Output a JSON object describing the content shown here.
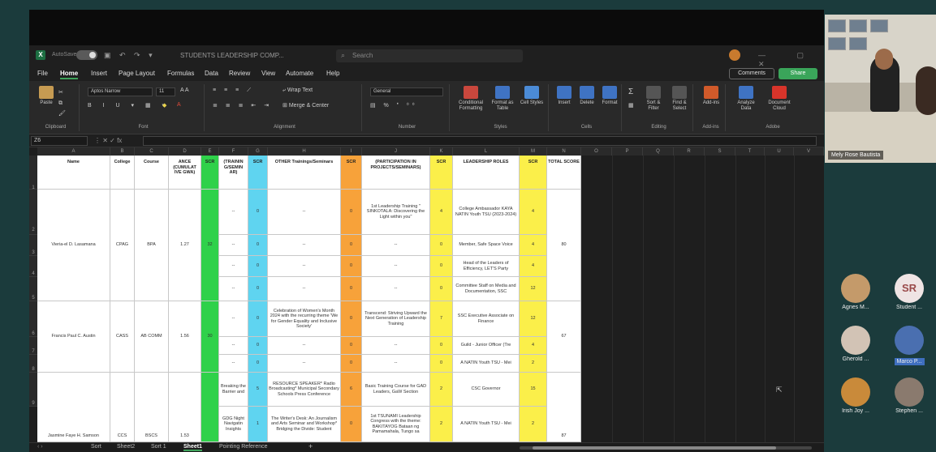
{
  "excel": {
    "title_bar": {
      "autosave": "AutoSave",
      "filename": "STUDENTS LEADERSHIP COMP...",
      "search_placeholder": "Search"
    },
    "menus": [
      "File",
      "Home",
      "Insert",
      "Page Layout",
      "Formulas",
      "Data",
      "Review",
      "View",
      "Automate",
      "Help"
    ],
    "comments_label": "Comments",
    "share_label": "Share",
    "ribbon": {
      "paste": "Paste",
      "clipboard": "Clipboard",
      "font_name": "Aptos Narrow",
      "font_size": "11",
      "font_group": "Font",
      "wrap_text": "Wrap Text",
      "merge_center": "Merge & Center",
      "alignment": "Alignment",
      "number_format": "General",
      "number": "Number",
      "conditional_formatting": "Conditional Formatting",
      "format_as_table": "Format as Table",
      "cell_styles": "Cell Styles",
      "styles": "Styles",
      "insert": "Insert",
      "delete": "Delete",
      "format": "Format",
      "cells": "Cells",
      "sort_filter": "Sort & Filter",
      "find_select": "Find & Select",
      "editing": "Editing",
      "addins": "Add-ins",
      "addins_group": "Add-ins",
      "analyze_data": "Analyze Data",
      "document_cloud": "Document Cloud",
      "adobe": "Adobe"
    },
    "name_box": "Z6",
    "columns": [
      "A",
      "B",
      "C",
      "D",
      "E",
      "F",
      "G",
      "H",
      "I",
      "J",
      "K",
      "L",
      "M",
      "N",
      "O",
      "P",
      "Q",
      "R",
      "S",
      "T",
      "U",
      "V"
    ],
    "rows": [
      "1",
      "2",
      "3",
      "4",
      "5",
      "6",
      "7",
      "8",
      "9"
    ],
    "headers": {
      "name": "Name",
      "college": "College",
      "course": "Course",
      "gwa": "ANCE (CUMULAT IVE GWA)",
      "scr": "SCR",
      "trainings": "(TRAININ G/SEMIN AR)",
      "other": "OTHER Trainings/Seminars",
      "projects": "(PARTICIPATION IN PROJECTS/SEMINARS)",
      "leadership": "LEADERSHIP ROLES",
      "total": "TOTAL SCORE"
    },
    "students": [
      {
        "name": "Vieria-el D. Lasamana",
        "college": "CPAG",
        "course": "BPA",
        "gwa": "1.27",
        "total": "80"
      },
      {
        "name": "Francis Paul C. Austin",
        "college": "CASS",
        "course": "AB COMM",
        "gwa": "1.56",
        "total": "67"
      },
      {
        "name": "Jasmine Faye H. Samson",
        "college": "CCS",
        "course": "BSCS",
        "gwa": "1.53",
        "total": "87"
      }
    ],
    "cells": {
      "dash": "--",
      "proj1": "1st Leadership Training \" SINKOTALA: Discovering the Light within you\"",
      "lead1": "College Ambassador KAYA NATIN Youth TSU (2023-2024)",
      "lead2": "Member, Safe Space Voice",
      "lead3": "Head of the Leaders of Efficiency, LET'S Party",
      "lead4": "Committee Staff on Media and Documentation, SSC",
      "other5": "Celebration of Women's Month 2024 with the recurring theme 'We for Gender Equality and Inclusive Society'",
      "proj5": "Transcend: Striving Upward the Next Generation of Leadership Training",
      "lead5": "SSC Executive Associate on Finance",
      "lead6": "Guild - Junior Officer (Tre",
      "lead7": "A NATIN Youth TSU - Mei",
      "train8": "Breaking the Barrier and",
      "other8": "RESOURCE SPEAKER* Radio Broadcasting* Municipal Secondary Schools Press Conference",
      "proj8": "Basic Training Course for GAD Leaders, GaW Section",
      "lead8": "CSC Governor",
      "train9": "GDG Night Navigatin Insights",
      "other9": "The Writer's Desk: An Journalism and Arts Seminar and Workshop* Bridging the Divide: Student",
      "proj9": "1st TSUNAMI Leadership Congress with the theme: BAKITAYOG Bataan ng Pamamahala, Tungo sa",
      "lead9": "A NATIN Youth TSU - Mei"
    },
    "scores": {
      "gwa_scr_1": "32",
      "gwa_scr_2": "30",
      "train_scr": [
        "0",
        "0",
        "0",
        "0",
        "0",
        "0",
        "0",
        "5",
        "1"
      ],
      "other_scr": [
        "0",
        "0",
        "0",
        "0",
        "0",
        "0",
        "0",
        "6",
        "0"
      ],
      "proj_scr": [
        "4",
        "0",
        "0",
        "0",
        "7",
        "0",
        "0",
        "2",
        "2"
      ],
      "lead_scr": [
        "4",
        "4",
        "4",
        "12",
        "12",
        "4",
        "2",
        "15",
        "2"
      ]
    },
    "sheet_tabs": [
      "Sort",
      "Sheet2",
      "Sort 1",
      "Sheet1",
      "Pointing Reference"
    ],
    "add_sheet": "+"
  },
  "meeting": {
    "video_name": "Mely Rose Bautista",
    "participants": [
      {
        "name": "Agnes M...",
        "initials": ""
      },
      {
        "name": "Student ...",
        "initials": "SR"
      },
      {
        "name": "Gherold ...",
        "initials": ""
      },
      {
        "name": "Marco P...",
        "initials": ""
      },
      {
        "name": "Irish Joy ...",
        "initials": ""
      },
      {
        "name": "Stephen ...",
        "initials": ""
      }
    ]
  }
}
